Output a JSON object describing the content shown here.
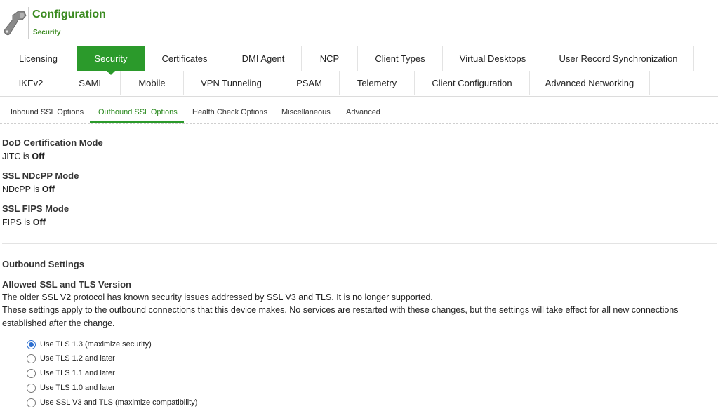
{
  "header": {
    "title": "Configuration",
    "subtitle": "Security",
    "icon": "wrench-icon"
  },
  "main_tabs": {
    "row1": [
      "Licensing",
      "Security",
      "Certificates",
      "DMI Agent",
      "NCP",
      "Client Types",
      "Virtual Desktops",
      "User Record Synchronization"
    ],
    "row2": [
      "IKEv2",
      "SAML",
      "Mobile",
      "VPN Tunneling",
      "PSAM",
      "Telemetry",
      "Client Configuration",
      "Advanced Networking"
    ],
    "active": "Security"
  },
  "sub_tabs": {
    "items": [
      "Inbound SSL Options",
      "Outbound SSL Options",
      "Health Check Options",
      "Miscellaneous",
      "Advanced"
    ],
    "active": "Outbound SSL Options"
  },
  "dod": {
    "title": "DoD Certification Mode",
    "prefix": "JITC is ",
    "value": "Off"
  },
  "ndcpp": {
    "title": "SSL NDcPP Mode",
    "prefix": "NDcPP is ",
    "value": "Off"
  },
  "fips": {
    "title": "SSL FIPS Mode",
    "prefix": "FIPS is ",
    "value": "Off"
  },
  "outbound": {
    "title": "Outbound Settings",
    "allowed_title": "Allowed SSL and TLS Version",
    "note1": "The older SSL V2 protocol has known security issues addressed by SSL V3 and TLS. It is no longer supported.",
    "note2": "These settings apply to the outbound connections that this device makes. No services are restarted with these changes, but the settings will take effect for all new connections established after the change.",
    "options": [
      "Use TLS 1.3 (maximize security)",
      "Use TLS 1.2 and later",
      "Use TLS 1.1 and later",
      "Use TLS 1.0 and later",
      "Use SSL V3 and TLS (maximize compatibility)"
    ],
    "selected_index": 0
  },
  "colors": {
    "accent": "#2b9a2b",
    "title_green": "#3a8a1f",
    "radio_selected": "#2c6fd1"
  }
}
